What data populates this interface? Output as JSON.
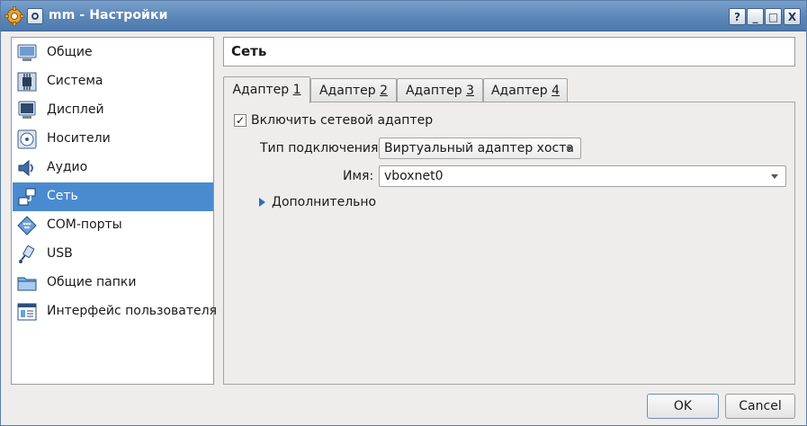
{
  "window": {
    "title": "mm - Настройки",
    "buttons": {
      "help": "?",
      "minimize": "_",
      "maximize": "□",
      "close": "X"
    }
  },
  "sidebar": {
    "selected_index": 5,
    "items": [
      {
        "label": "Общие",
        "icon": "general-monitor-icon"
      },
      {
        "label": "Система",
        "icon": "system-chip-icon"
      },
      {
        "label": "Дисплей",
        "icon": "display-monitor-icon"
      },
      {
        "label": "Носители",
        "icon": "storage-disc-icon"
      },
      {
        "label": "Аудио",
        "icon": "audio-speaker-icon"
      },
      {
        "label": "Сеть",
        "icon": "network-icon"
      },
      {
        "label": "COM-порты",
        "icon": "serial-port-icon"
      },
      {
        "label": "USB",
        "icon": "usb-icon"
      },
      {
        "label": "Общие папки",
        "icon": "shared-folder-icon"
      },
      {
        "label": "Интерфейс пользователя",
        "icon": "user-interface-icon"
      }
    ]
  },
  "page": {
    "title": "Сеть"
  },
  "tabs": [
    {
      "label": "Адаптер ",
      "key": "1",
      "active": true
    },
    {
      "label": "Адаптер ",
      "key": "2",
      "active": false
    },
    {
      "label": "Адаптер ",
      "key": "3",
      "active": false
    },
    {
      "label": "Адаптер ",
      "key": "4",
      "active": false
    }
  ],
  "adapter": {
    "enable_label": "Включить сетевой адаптер",
    "enabled": true,
    "check_mark": "✓",
    "attached_label": "Тип подключения:",
    "attached_value": "Виртуальный адаптер хоста",
    "name_label": "Имя:",
    "name_value": "vboxnet0",
    "advanced_label": "Дополнительно"
  },
  "footer": {
    "ok_label": "OK",
    "cancel_label": "Cancel"
  },
  "colors": {
    "titlebar": "#5b86b8",
    "selection": "#4a8bcf",
    "expander": "#2f6eb8"
  }
}
